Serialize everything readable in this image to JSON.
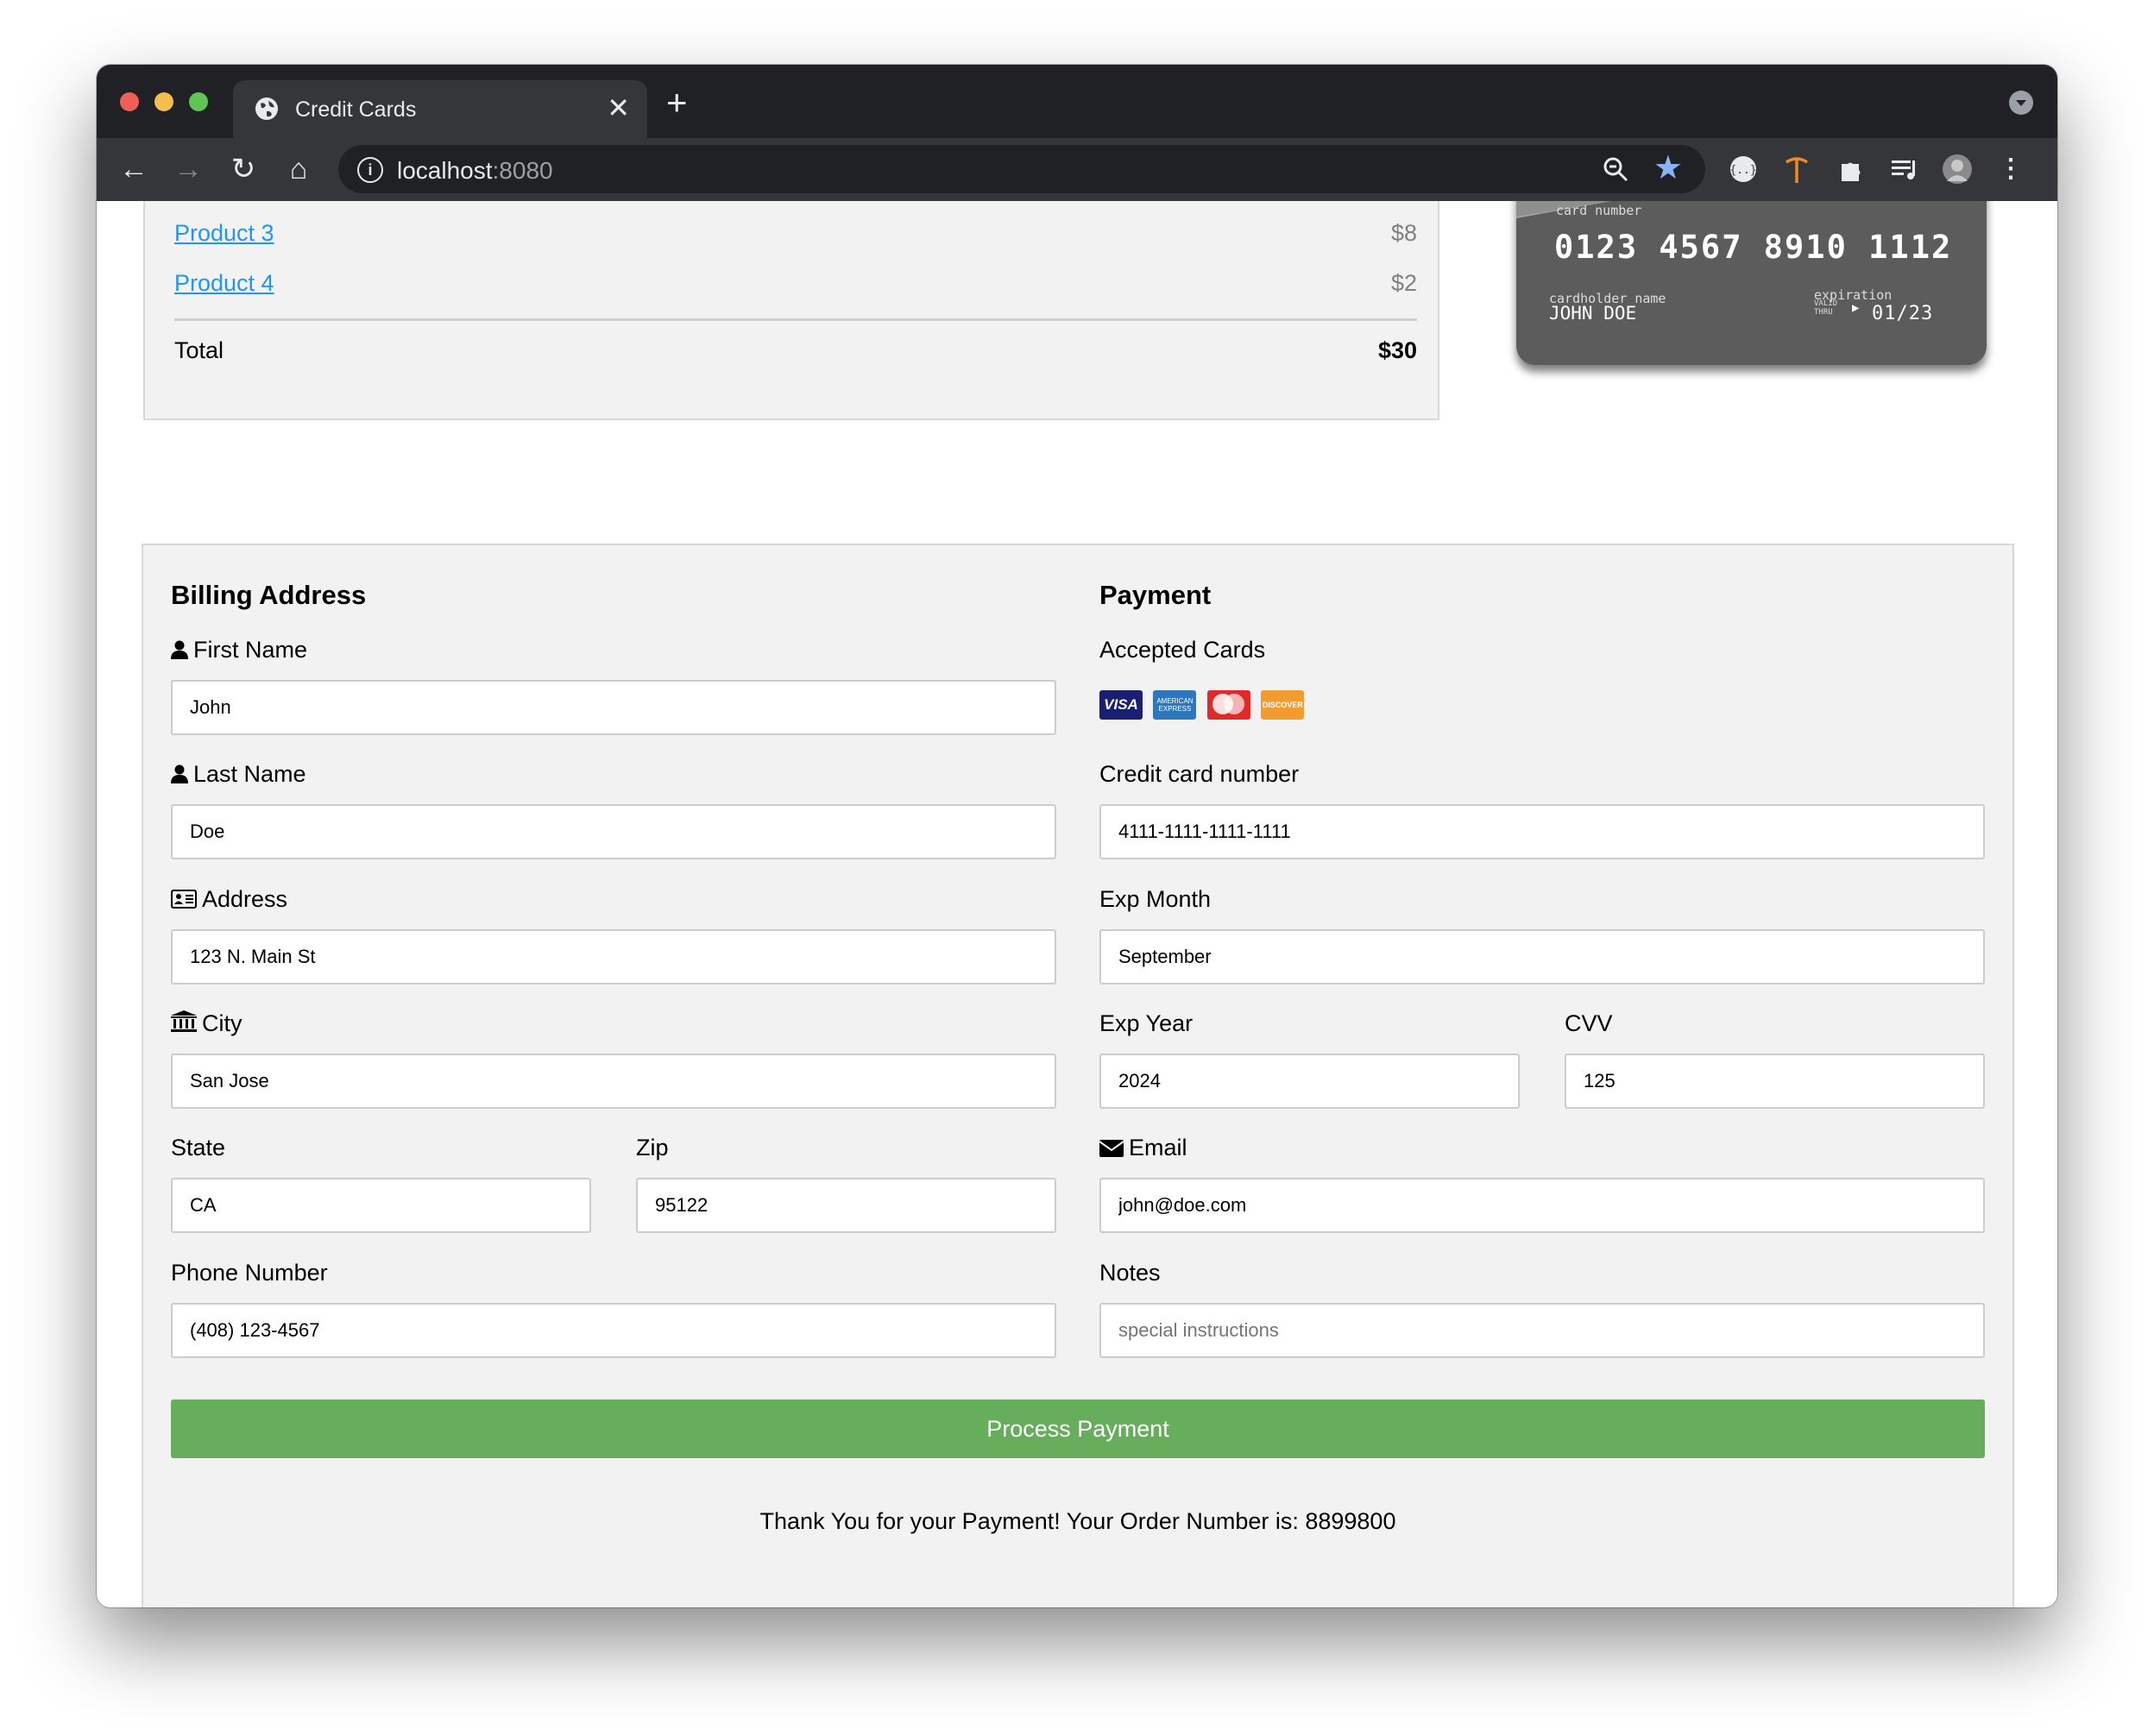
{
  "browser": {
    "tab_title": "Credit Cards",
    "url_host": "localhost",
    "url_port": ":8080"
  },
  "cart": {
    "items": [
      {
        "name": "Product 3",
        "price": "$8"
      },
      {
        "name": "Product 4",
        "price": "$2"
      }
    ],
    "total_label": "Total",
    "total_value": "$30"
  },
  "card_preview": {
    "number_label": "card number",
    "number": "0123 4567 8910 1112",
    "name_label": "cardholder name",
    "name": "JOHN DOE",
    "expiration_label": "expiration",
    "valid_thru_line1": "VALID",
    "valid_thru_line2": "THRU",
    "expiration": "01/23"
  },
  "billing": {
    "heading": "Billing Address",
    "first_name_label": "First Name",
    "first_name": "John",
    "last_name_label": "Last Name",
    "last_name": "Doe",
    "address_label": "Address",
    "address": "123 N. Main St",
    "city_label": "City",
    "city": "San Jose",
    "state_label": "State",
    "state": "CA",
    "zip_label": "Zip",
    "zip": "95122",
    "phone_label": "Phone Number",
    "phone": "(408) 123-4567"
  },
  "payment": {
    "heading": "Payment",
    "accepted_label": "Accepted Cards",
    "accepted_cards": [
      "visa-card-icon",
      "amex-card-icon",
      "mastercard-card-icon",
      "discover-card-icon"
    ],
    "visa_text": "VISA",
    "amex_text": "AMERICAN EXPRESS",
    "discover_text": "DISCOVER",
    "cc_number_label": "Credit card number",
    "cc_number": "4111-1111-1111-1111",
    "exp_month_label": "Exp Month",
    "exp_month": "September",
    "exp_year_label": "Exp Year",
    "exp_year": "2024",
    "cvv_label": "CVV",
    "cvv": "125",
    "email_label": "Email",
    "email": "john@doe.com",
    "notes_label": "Notes",
    "notes_placeholder": "special instructions",
    "notes": ""
  },
  "submit_label": "Process Payment",
  "confirmation": "Thank You for your Payment! Your Order Number is: 8899800",
  "colors": {
    "pay_button": "#66ae5b",
    "link": "#2196f3",
    "card_background": "#5c5c5c"
  }
}
